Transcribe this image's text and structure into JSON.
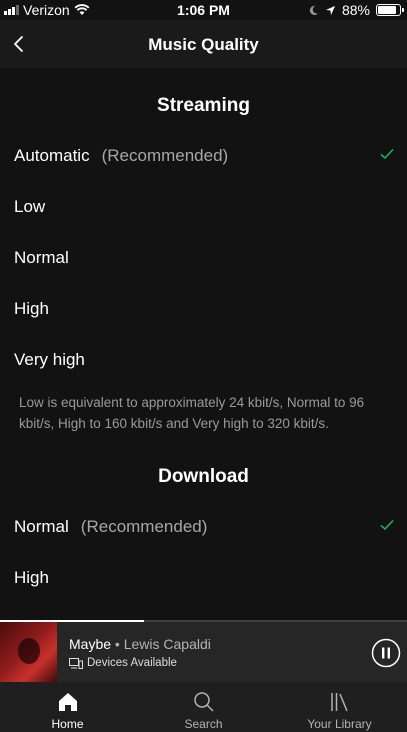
{
  "status_bar": {
    "carrier": "Verizon",
    "time": "1:06 PM",
    "battery": "88%",
    "battery_level": 0.88
  },
  "header": {
    "title": "Music Quality",
    "back_icon": "chevron-left-icon"
  },
  "streaming": {
    "title": "Streaming",
    "options": [
      {
        "label": "Automatic",
        "note": "(Recommended)",
        "selected": true
      },
      {
        "label": "Low",
        "selected": false
      },
      {
        "label": "Normal",
        "selected": false
      },
      {
        "label": "High",
        "selected": false
      },
      {
        "label": "Very high",
        "selected": false
      }
    ],
    "info": "Low is equivalent to approximately 24 kbit/s, Normal to 96 kbit/s, High to 160 kbit/s and Very high to 320 kbit/s."
  },
  "download": {
    "title": "Download",
    "options": [
      {
        "label": "Normal",
        "note": "(Recommended)",
        "selected": true
      },
      {
        "label": "High",
        "selected": false
      }
    ]
  },
  "player": {
    "song": "Maybe",
    "separator": "•",
    "artist": "Lewis Capaldi",
    "devices": "Devices Available",
    "progress": 0.355
  },
  "nav": {
    "items": [
      {
        "label": "Home",
        "icon": "home-icon",
        "active": true
      },
      {
        "label": "Search",
        "icon": "search-icon",
        "active": false
      },
      {
        "label": "Your Library",
        "icon": "library-icon",
        "active": false
      }
    ]
  },
  "colors": {
    "background": "#121212",
    "accent_check": "#1db954",
    "secondary_text": "#a7a7a7"
  }
}
